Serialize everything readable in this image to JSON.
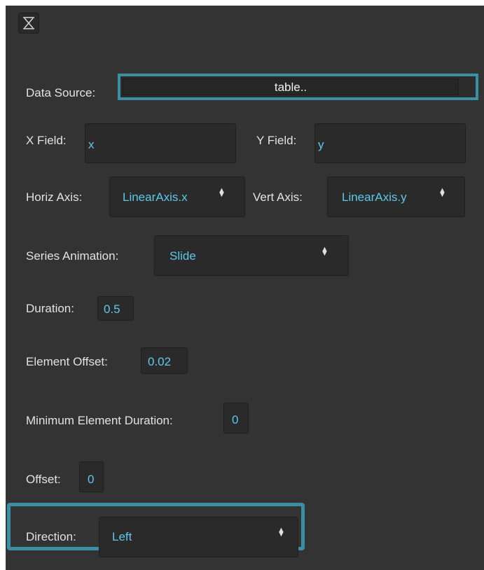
{
  "panel": {
    "close_icon": "close-icon",
    "accent_color": "#3b8fa3",
    "value_color": "#5ec8ea"
  },
  "data_source": {
    "label": "Data Source:",
    "value": "table.."
  },
  "x_field": {
    "label": "X Field:",
    "value": "x"
  },
  "y_field": {
    "label": "Y Field:",
    "value": "y"
  },
  "horiz_axis": {
    "label": "Horiz Axis:",
    "value": "LinearAxis.x"
  },
  "vert_axis": {
    "label": "Vert Axis:",
    "value": "LinearAxis.y"
  },
  "series_animation": {
    "label": "Series Animation:",
    "value": "Slide"
  },
  "duration": {
    "label": "Duration:",
    "value": "0.5"
  },
  "element_offset": {
    "label": "Element Offset:",
    "value": "0.02"
  },
  "min_element_duration": {
    "label": "Minimum Element Duration:",
    "value": "0"
  },
  "offset": {
    "label": "Offset:",
    "value": "0"
  },
  "direction": {
    "label": "Direction:",
    "value": "Left"
  }
}
